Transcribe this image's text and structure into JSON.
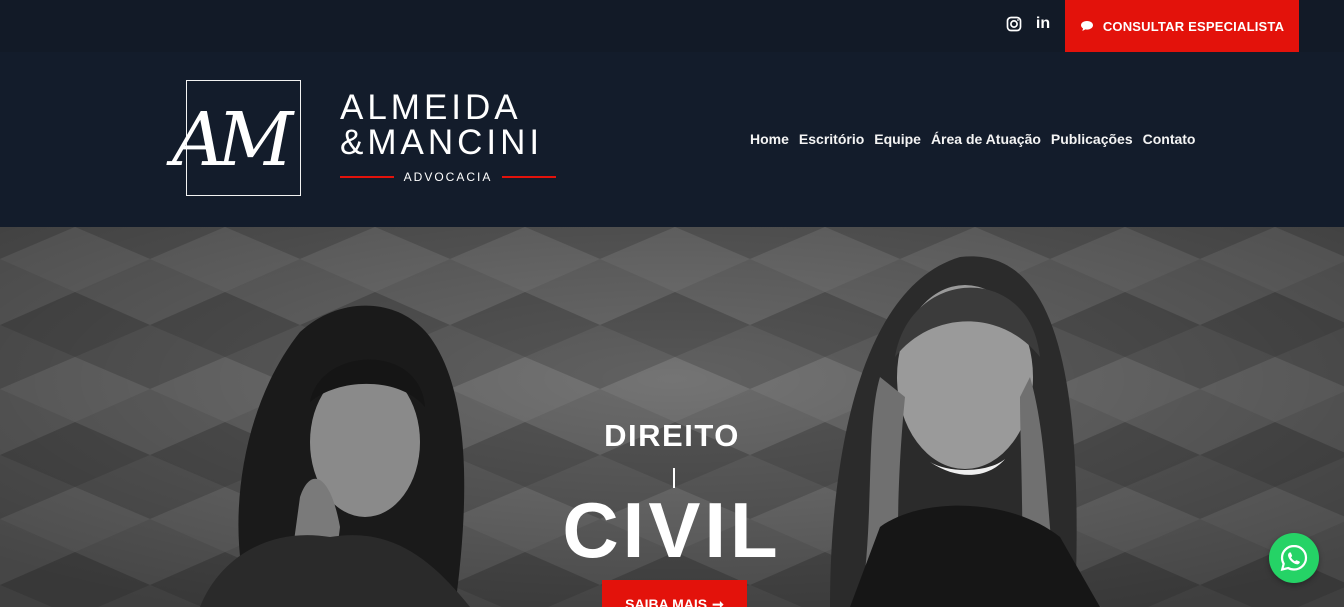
{
  "topbar": {
    "social": [
      {
        "name": "instagram",
        "icon": "instagram-icon"
      },
      {
        "name": "linkedin",
        "icon": "linkedin-icon",
        "glyph": "in"
      }
    ],
    "cta_label": "CONSULTAR ESPECIALISTA",
    "cta_icon": "chat-bubble-icon"
  },
  "logo": {
    "monogram": "AM",
    "name_line1": "ALMEIDA",
    "name_line2": "&MANCINI",
    "subtitle": "ADVOCACIA"
  },
  "nav": {
    "items": [
      "Home",
      "Escritório",
      "Equipe",
      "Área de Atuação",
      "Publicações",
      "Contato"
    ]
  },
  "hero": {
    "title_small": "DIREITO",
    "title_big": "CIVIL",
    "button_label": "SAIBA MAIS",
    "button_arrow": "➞"
  },
  "floating": {
    "whatsapp_icon": "whatsapp-icon"
  },
  "colors": {
    "accent": "#e3120b",
    "navy": "#131c2b",
    "whatsapp": "#25d366"
  }
}
